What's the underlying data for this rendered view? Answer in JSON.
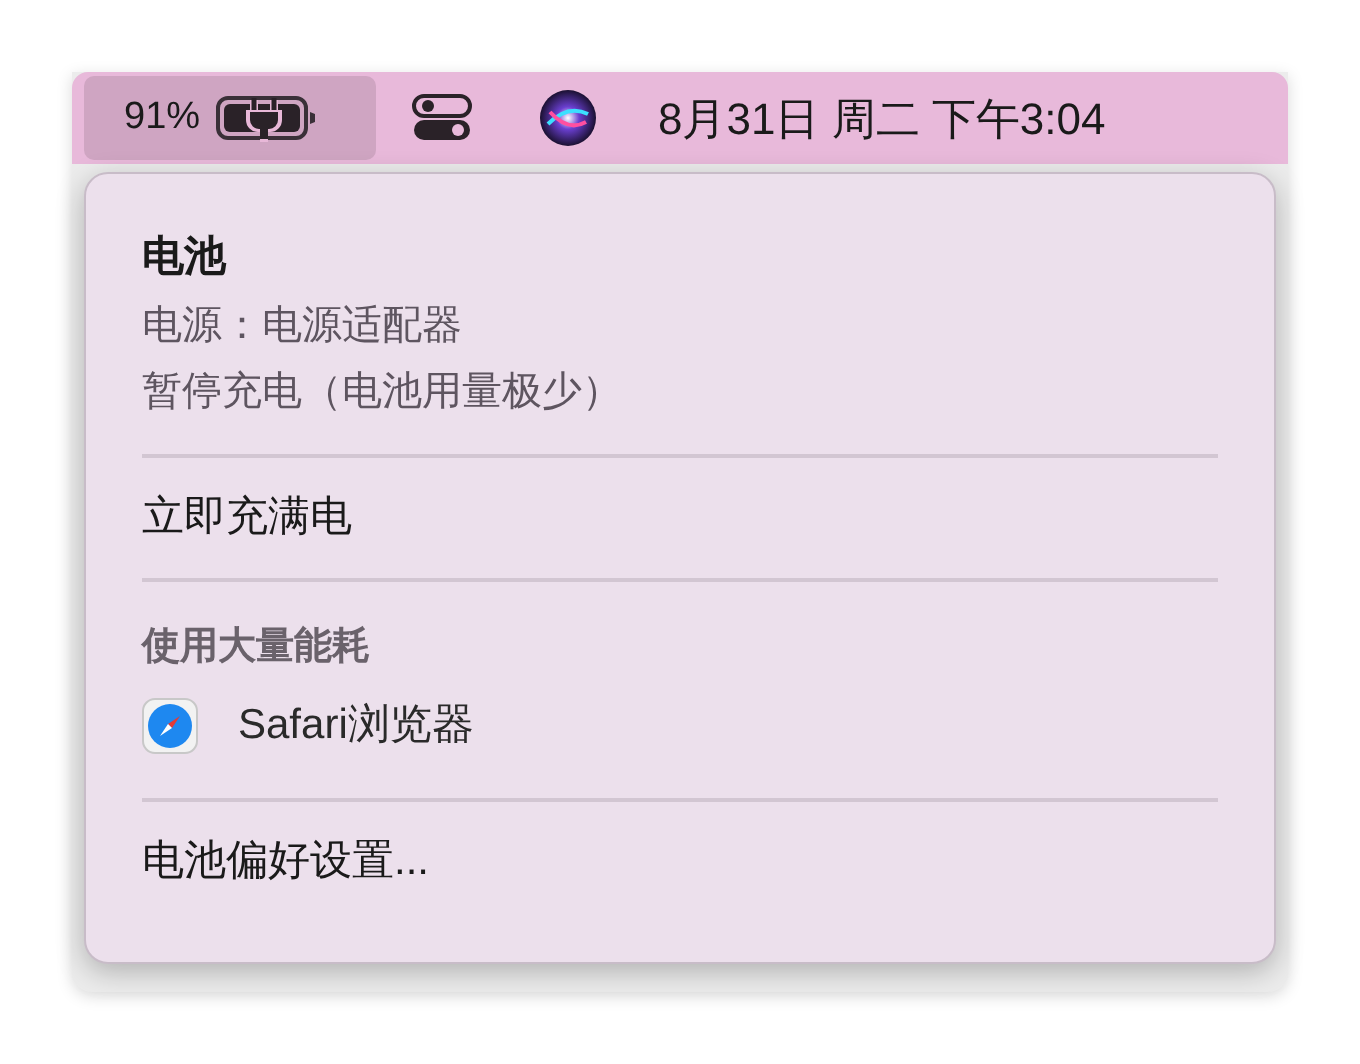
{
  "menu_bar": {
    "battery": {
      "percent": "91%",
      "selected": true
    },
    "date_time": "8月31日 周二 下午3:04"
  },
  "battery_menu": {
    "title": "电池",
    "items": [
      {
        "kind": "info",
        "text": "电源：电源适配器"
      },
      {
        "kind": "info",
        "text": "暂停充电（电池用量极少）"
      },
      {
        "kind": "separator"
      },
      {
        "kind": "action",
        "text": "立即充满电"
      },
      {
        "kind": "separator"
      },
      {
        "kind": "header",
        "text": "使用大量能耗"
      },
      {
        "kind": "app",
        "text": "Safari浏览器"
      },
      {
        "kind": "separator"
      },
      {
        "kind": "action",
        "text": "电池偏好设置..."
      }
    ]
  }
}
